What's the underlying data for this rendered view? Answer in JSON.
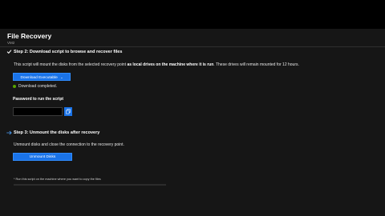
{
  "header": {
    "title": "File Recovery",
    "subtitle": "VM2"
  },
  "step2": {
    "title": "Step 2: Download script to browse and recover files",
    "description_prefix": "This script will mount the disks from the selected recovery point ",
    "description_bold": "as local drives on the machine where it is run",
    "description_suffix": ". These drives will remain mounted for 12 hours.",
    "download_button": "Download Executable",
    "status": "Download completed.",
    "password_label": "Password to run the script"
  },
  "step3": {
    "title": "Step 3: Unmount the disks after recovery",
    "description": "Unmount disks and close the connection to the recovery point.",
    "unmount_button": "Unmount Disks"
  },
  "footnotes": {
    "line1": "* Run this script on the machine where you want to copy the files"
  },
  "colors": {
    "accent": "#1a73e8",
    "success": "#57a300",
    "background": "#161616"
  }
}
